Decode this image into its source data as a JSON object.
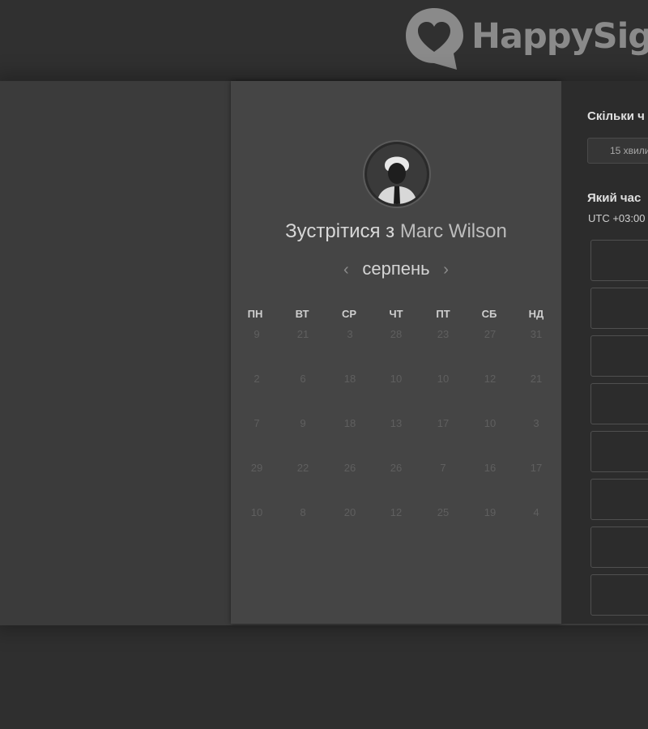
{
  "brand": {
    "name": "HappySig",
    "logo_icon": "heart-speech-bubble-icon"
  },
  "booking": {
    "title_prefix": "Зустрітися з",
    "host_name": "Marc Wilson",
    "avatar": "host-avatar-photo",
    "month": "серпень",
    "prev_icon": "chevron-left-icon",
    "next_icon": "chevron-right-icon",
    "weekdays": [
      "ПН",
      "ВТ",
      "СР",
      "ЧТ",
      "ПТ",
      "СБ",
      "НД"
    ],
    "weeks": [
      [
        "9",
        "21",
        "3",
        "28",
        "23",
        "27",
        "31"
      ],
      [
        "2",
        "6",
        "18",
        "10",
        "10",
        "12",
        "21"
      ],
      [
        "7",
        "9",
        "18",
        "13",
        "17",
        "10",
        "3"
      ],
      [
        "29",
        "22",
        "26",
        "26",
        "7",
        "16",
        "17"
      ],
      [
        "10",
        "8",
        "20",
        "12",
        "25",
        "19",
        "4"
      ]
    ]
  },
  "side_panel": {
    "duration_question": "Скільки ч",
    "duration_option": "15 хвили",
    "time_question": "Який час",
    "timezone": "UTC +03:00",
    "time_slots": [
      "",
      "",
      "",
      "",
      "",
      "",
      "",
      ""
    ]
  }
}
